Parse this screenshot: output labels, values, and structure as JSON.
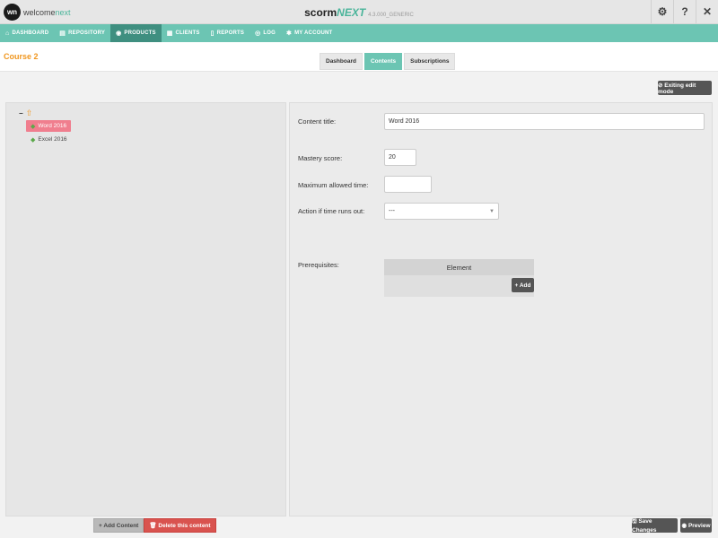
{
  "topbar": {
    "logo_mark": "wn",
    "logo_text_a": "welcome",
    "logo_text_b": "next",
    "app_name_a": "scorm",
    "app_name_b": "NEXT",
    "app_version": "4.3.000_GENERIC",
    "settings_glyph": "⚙",
    "help_glyph": "?",
    "close_glyph": "✕"
  },
  "nav": {
    "items": [
      {
        "label": "DASHBOARD",
        "icon": "home-icon",
        "glyph": "⌂"
      },
      {
        "label": "REPOSITORY",
        "icon": "repository-icon",
        "glyph": "▤"
      },
      {
        "label": "PRODUCTS",
        "icon": "products-icon",
        "glyph": "◉"
      },
      {
        "label": "CLIENTS",
        "icon": "clients-icon",
        "glyph": "▦"
      },
      {
        "label": "REPORTS",
        "icon": "reports-icon",
        "glyph": "▯"
      },
      {
        "label": "LOG",
        "icon": "log-icon",
        "glyph": "◎"
      },
      {
        "label": "MY ACCOUNT",
        "icon": "account-icon",
        "glyph": "✱"
      }
    ],
    "active_index": 2,
    "accent_color": "#6cc5b3"
  },
  "course": {
    "title": "Course 2"
  },
  "tabs": [
    {
      "label": "Dashboard"
    },
    {
      "label": "Contents"
    },
    {
      "label": "Subscriptions"
    }
  ],
  "exit_edit_label": "⊘ Exiting edit mode",
  "tree": {
    "root_toggle": "−",
    "root_glyph": "⇧",
    "nodes": [
      {
        "label": "Word 2016",
        "selected": true
      },
      {
        "label": "Excel 2016",
        "selected": false
      }
    ]
  },
  "left_actions": {
    "add_label": "+ Add Content",
    "delete_label": "🗑 Delete this content"
  },
  "form": {
    "content_title_label": "Content title:",
    "content_title_value": "Word 2016",
    "mastery_label": "Mastery score:",
    "mastery_value": "20",
    "max_time_label": "Maximum allowed time:",
    "max_time_value": "",
    "action_label": "Action if time runs out:",
    "action_value": "---",
    "prereq_label": "Prerequisites:",
    "prereq_column": "Element",
    "prereq_add_label": "+ Add"
  },
  "footer": {
    "save_label": "🖫 Save Changes",
    "preview_label": "◉ Preview"
  }
}
